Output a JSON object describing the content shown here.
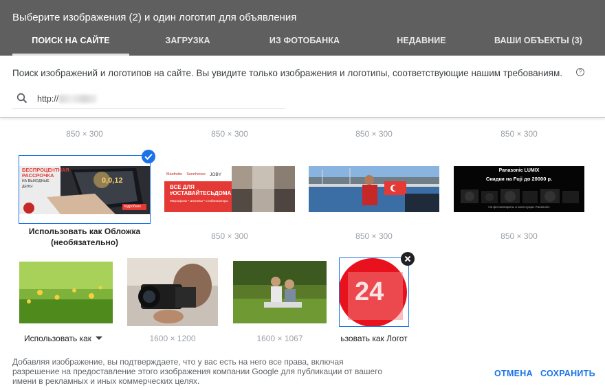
{
  "dialog": {
    "title": "Выберите изображения (2) и один логотип для объявления"
  },
  "tabs": [
    {
      "label": "ПОИСК НА САЙТЕ",
      "active": true
    },
    {
      "label": "ЗАГРУЗКА",
      "active": false
    },
    {
      "label": "ИЗ ФОТОБАНКА",
      "active": false
    },
    {
      "label": "НЕДАВНИЕ",
      "active": false
    },
    {
      "label": "ВАШИ ОБЪЕКТЫ (3)",
      "active": false
    }
  ],
  "description": "Поиск изображений и логотипов на сайте. Вы увидите только изображения и логотипы, соответствующие нашим требованиям.",
  "help_icon": "help-circle-icon",
  "search": {
    "value": "http://",
    "icon": "search-icon"
  },
  "top_row_dims": [
    "850 × 300",
    "850 × 300",
    "850 × 300",
    "850 × 300"
  ],
  "row1": [
    {
      "selected": true,
      "caption": "Использовать как Обложка",
      "caption2": "(необязательно)",
      "banner_lines": [
        "БЕСПРОЦЕНТНАЯ",
        "РАССРОЧКА",
        "НА ВЫХОДНЫЕ",
        "ДЕНЬ!"
      ],
      "badge": "0,0,12",
      "button": "подробнее"
    },
    {
      "dims": "850 × 300",
      "brands": [
        "Manfrotto",
        "Sennheiser",
        "JOBY"
      ],
      "headline": [
        "ВСЕ ДЛЯ",
        "#ОСТАВАЙТЕСЬДОМА"
      ],
      "subline": "Микрофоны • Штативы • Стабилизаторы"
    },
    {
      "dims": "850 × 300"
    },
    {
      "dims": "850 × 300",
      "brand": "Panasonic LUMIX",
      "promo": "Скидки на Fuji до 20000 р.",
      "footer": "На фотоаппараты и аксессуары Panasonic"
    }
  ],
  "row2": [
    {
      "dropdown_label": "Использовать как"
    },
    {
      "dims": "1600 × 1200"
    },
    {
      "dims": "1600 × 1067"
    },
    {
      "caption": "ьзовать как Логот",
      "logo_text": "24",
      "selected": true
    }
  ],
  "footer": {
    "text": "Добавляя изображение, вы подтверждаете, что у вас есть на него все права, включая разрешение на предоставление этого изображения компании Google для публикации от вашего имени в рекламных и иных коммерческих целях.",
    "cancel": "ОТМЕНА",
    "save": "СОХРАНИТЬ"
  },
  "colors": {
    "header": "#5f5f5f",
    "accent": "#1a73e8"
  }
}
